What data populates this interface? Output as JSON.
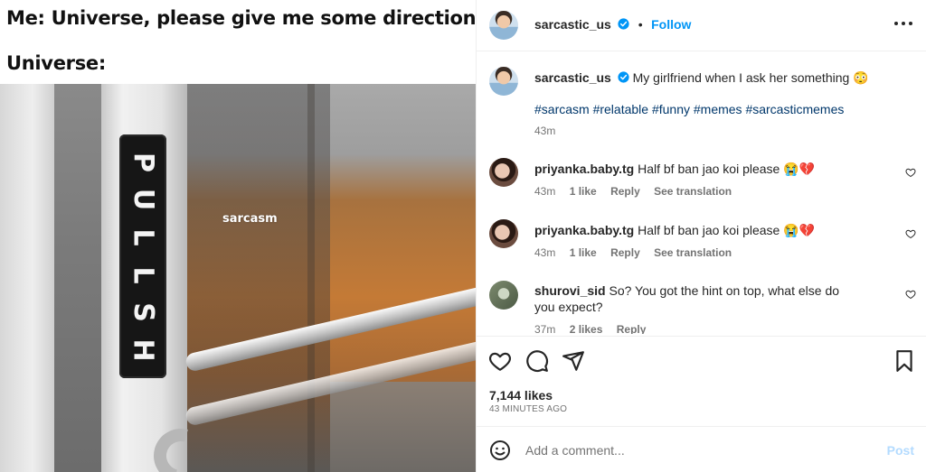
{
  "meme": {
    "caption_line1": "Me: Universe, please give me some direction..",
    "caption_line2": "Universe:",
    "sign_text": "PULLSH",
    "watermark": "sarcasm"
  },
  "header": {
    "username": "sarcastic_us",
    "follow_label": "Follow",
    "separator": "•"
  },
  "caption": {
    "username": "sarcastic_us",
    "text": "My girlfriend when I ask her something 😳",
    "hashtags": "#sarcasm #relatable #funny #memes #sarcasticmemes",
    "time": "43m"
  },
  "comments": [
    {
      "username": "priyanka.baby.tg",
      "text": "Half bf ban jao koi please 😭💔",
      "time": "43m",
      "likes": "1 like",
      "reply": "Reply",
      "translate": "See translation"
    },
    {
      "username": "priyanka.baby.tg",
      "text": "Half bf ban jao koi please 😭💔",
      "time": "43m",
      "likes": "1 like",
      "reply": "Reply",
      "translate": "See translation"
    },
    {
      "username": "shurovi_sid",
      "text": "So? You got the hint on top, what else do you expect?",
      "time": "37m",
      "likes": "2 likes",
      "reply": "Reply"
    }
  ],
  "stats": {
    "likes": "7,144 likes",
    "time_ago": "43 MINUTES AGO"
  },
  "comment_box": {
    "placeholder": "Add a comment...",
    "post_label": "Post"
  },
  "colors": {
    "accent": "#0095f6",
    "verified": "#0095f6",
    "hashtag": "#00376b",
    "muted": "#737373",
    "post_disabled": "#b3dbff"
  }
}
